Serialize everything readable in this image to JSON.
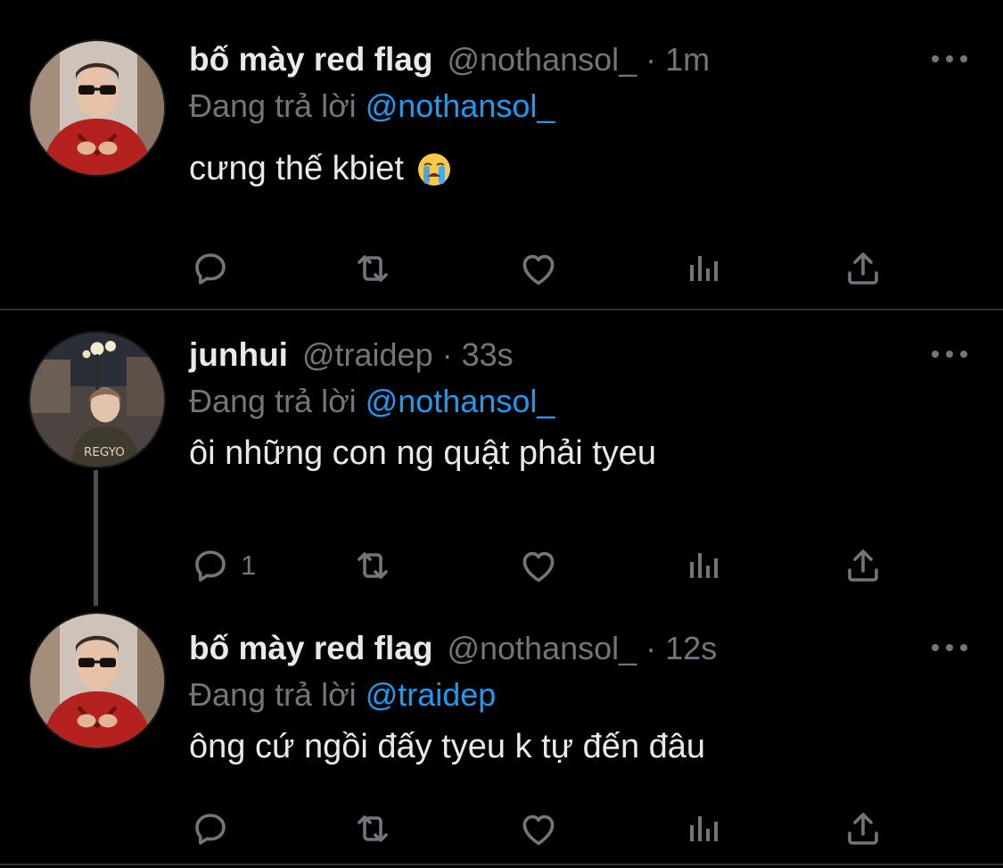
{
  "colors": {
    "background": "#000000",
    "text": "#e7e9ea",
    "muted": "#71767b",
    "link": "#1d9bf0",
    "divider": "#2f3336"
  },
  "tweets": [
    {
      "display_name": "bố mày red flag",
      "handle": "@nothansol_",
      "separator": "·",
      "time": "1m",
      "reply_prefix": "Đang trả lời",
      "reply_to": "@nothansol_",
      "text": "cưng thế kbiet",
      "emoji": "loudly-crying-face",
      "reply_count": "",
      "avatar": "avatar-red-shirt"
    },
    {
      "display_name": "junhui",
      "handle": "@traidep",
      "separator": "·",
      "time": "33s",
      "reply_prefix": "Đang trả lời",
      "reply_to": "@nothansol_",
      "text": "ôi những con ng quật phải tyeu",
      "reply_count": "1",
      "avatar": "avatar-street-night"
    },
    {
      "display_name": "bố mày red flag",
      "handle": "@nothansol_",
      "separator": "·",
      "time": "12s",
      "reply_prefix": "Đang trả lời",
      "reply_to": "@traidep",
      "text": "ông cứ ngồi đấy tyeu k tự đến đâu",
      "reply_count": "",
      "avatar": "avatar-red-shirt"
    }
  ],
  "action_icons": [
    "reply-icon",
    "retweet-icon",
    "like-icon",
    "views-icon",
    "share-icon"
  ]
}
